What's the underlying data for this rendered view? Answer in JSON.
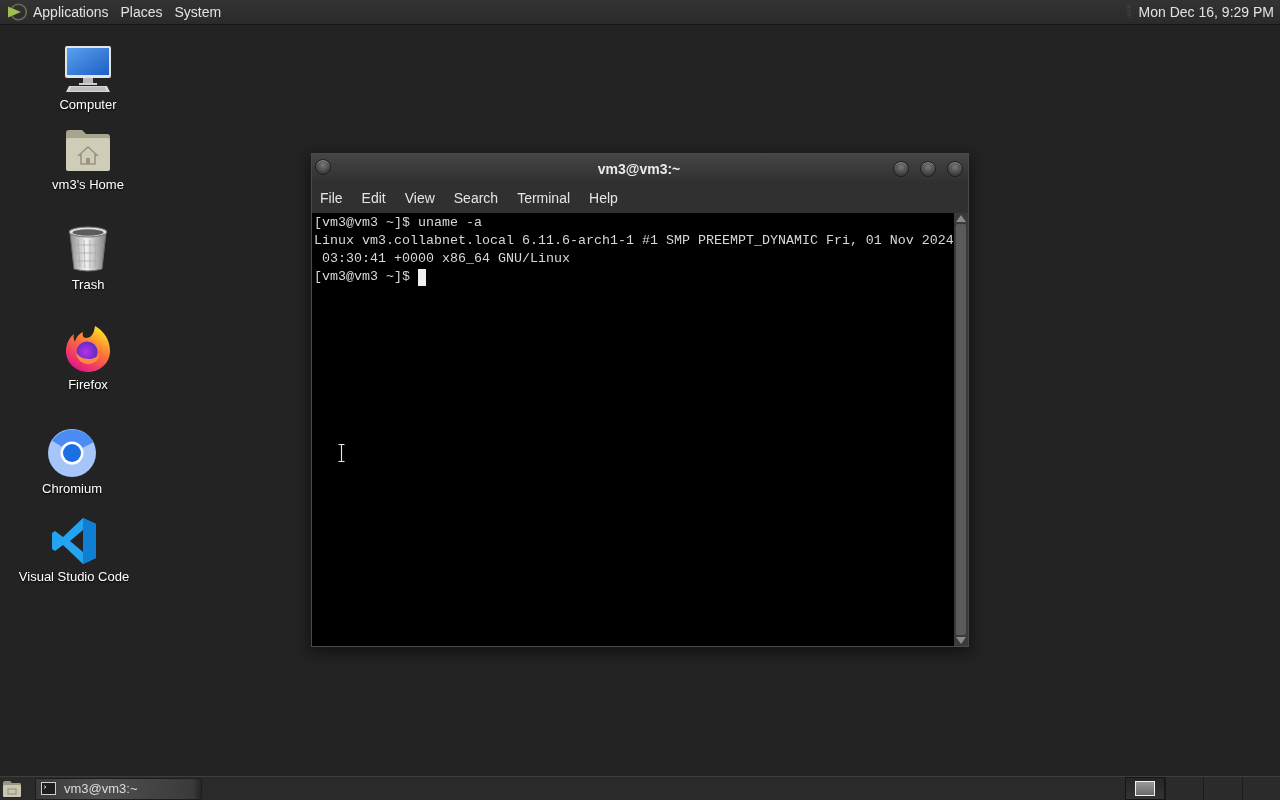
{
  "top_panel": {
    "menus": [
      "Applications",
      "Places",
      "System"
    ],
    "clock": "Mon Dec 16, 9:29 PM"
  },
  "desktop_icons": [
    {
      "kind": "computer",
      "label": "Computer"
    },
    {
      "kind": "home",
      "label": "vm3's Home"
    },
    {
      "kind": "trash",
      "label": "Trash"
    },
    {
      "kind": "firefox",
      "label": "Firefox"
    },
    {
      "kind": "chromium",
      "label": "Chromium"
    },
    {
      "kind": "vscode",
      "label": "Visual Studio Code"
    }
  ],
  "terminal_window": {
    "title": "vm3@vm3:~",
    "menu": [
      "File",
      "Edit",
      "View",
      "Search",
      "Terminal",
      "Help"
    ],
    "lines": [
      {
        "text": "[vm3@vm3 ~]$ uname -a",
        "cursor": false
      },
      {
        "text": "Linux vm3.collabnet.local 6.11.6-arch1-1 #1 SMP PREEMPT_DYNAMIC Fri, 01 Nov 2024",
        "cursor": false
      },
      {
        "text": " 03:30:41 +0000 x86_64 GNU/Linux",
        "cursor": false
      },
      {
        "text": "[vm3@vm3 ~]$",
        "cursor": true
      }
    ]
  },
  "taskbar": {
    "tasks": [
      {
        "label": "vm3@vm3:~",
        "selected": true
      }
    ],
    "workspaces": [
      {
        "selected": true,
        "has_window": true
      },
      {
        "selected": false,
        "has_window": false
      },
      {
        "selected": false,
        "has_window": false
      },
      {
        "selected": false,
        "has_window": false
      }
    ]
  }
}
